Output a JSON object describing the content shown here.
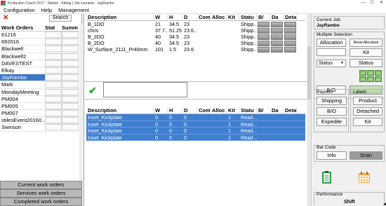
{
  "window": {
    "title": "Production Coach 2017 - Station : Kitting | Job courante : JayRambo"
  },
  "menu": [
    "Configuration",
    "Help",
    "Management"
  ],
  "left": {
    "search_label": "Search",
    "headers": [
      "Work Orders",
      "Stat",
      "Summ"
    ],
    "orders": [
      "61216",
      "692016",
      "Blackwell",
      "Blackwell2",
      "DAVESTEST",
      "Elkay",
      "JayRambo",
      "Mark",
      "MondayMeeting",
      "PM004",
      "PM005",
      "PM007",
      "stilesEvent20160...",
      "Swinson"
    ],
    "selected_index": 6,
    "bottom_buttons": [
      "Current work orders",
      "Services work orders",
      "Completed work orders"
    ]
  },
  "grid_top": {
    "headers": [
      "Description",
      "W",
      "H",
      "D",
      "Com",
      "Alloc",
      "Kit",
      "Statu",
      "B/",
      "Da",
      "Deta"
    ],
    "rows": [
      [
        "B_1DO",
        "21",
        "34.5",
        "23",
        "",
        "",
        "",
        "Shipp..."
      ],
      [
        "chris",
        "37.7...",
        "51.25",
        "23.6...",
        "",
        "",
        "",
        "Shipp..."
      ],
      [
        "B_2DO",
        "40",
        "34.5",
        "23",
        "",
        "",
        "",
        "Shipp..."
      ],
      [
        "B_2DO",
        "40",
        "34.5",
        "23",
        "",
        "",
        "",
        "Shipp..."
      ],
      [
        "W_Surface_2111_Pr40mm",
        "101",
        "1.5",
        "23.6",
        "",
        "",
        "",
        "Shipp..."
      ]
    ]
  },
  "grid_bottom": {
    "headers": [
      "Description",
      "W",
      "H",
      "D",
      "Com",
      "Alloc",
      "Kit",
      "Statu",
      "B/",
      "Da",
      "Deta"
    ],
    "rows": [
      [
        "Inset_Kickplate",
        "0",
        "0",
        "0",
        "",
        "",
        "1",
        "Read..."
      ],
      [
        "Inset_Kickplate",
        "0",
        "0",
        "0",
        "",
        "",
        "1",
        "Read..."
      ],
      [
        "Inset_Kickplate",
        "0",
        "0",
        "0",
        "",
        "",
        "1",
        "Read..."
      ],
      [
        "Inset_Kickplate",
        "0",
        "0",
        "0",
        "",
        "",
        "1",
        "Read..."
      ]
    ]
  },
  "right": {
    "current_job_label": "Current Job",
    "current_job_value": "JayRambo",
    "multiple_selection_label": "Multiple Selection",
    "allocation_label": "Allocation",
    "reset_allocation_label": "Reset Allocation",
    "kit_label": "Kit",
    "status_select": "Status",
    "status_btn": "Status",
    "bo_label": "B/O",
    "small_btns": [
      "A1",
      "A2",
      "A3",
      "A4",
      "A5",
      "A6"
    ],
    "reports_label": "Reports",
    "labels_label": "Labels",
    "shipping_label": "Shipping",
    "product_label": "Product",
    "reports_bo_label": "B/O",
    "detached_label": "Detached",
    "expedite_label": "Expedite",
    "labels_kit_label": "Kit",
    "barcode_label": "Bar Code",
    "info_label": "Info",
    "scan_label": "Scan",
    "performance_label": "Performance",
    "shift_label": "Shift"
  },
  "colors": {
    "selection_blue": "#3f7fd0",
    "accent_green": "#7fbf5f"
  }
}
